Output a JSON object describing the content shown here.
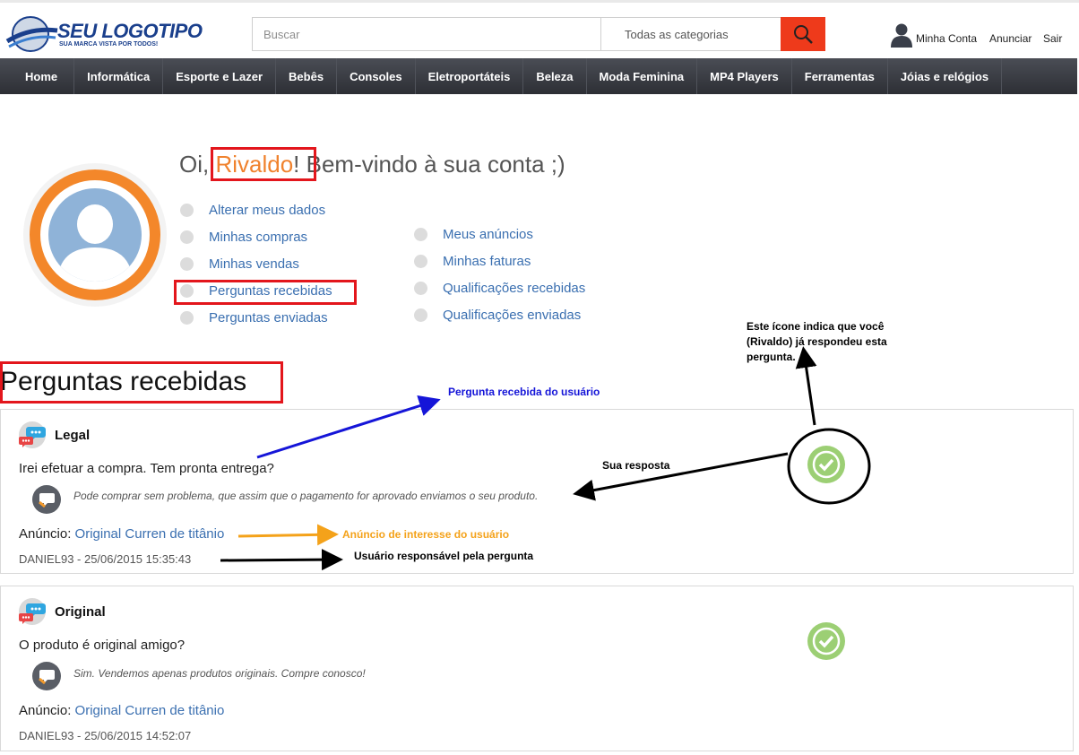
{
  "header": {
    "logo_text": "SEU LOGOTIPO",
    "logo_tagline": "SUA MARCA VISTA POR TODOS!",
    "search_placeholder": "Buscar",
    "category_select": "Todas as categorias",
    "links": {
      "account": "Minha Conta",
      "advertise": "Anunciar",
      "logout": "Sair"
    }
  },
  "nav": [
    "Home",
    "Informática",
    "Esporte e Lazer",
    "Bebês",
    "Consoles",
    "Eletroportáteis",
    "Beleza",
    "Moda Feminina",
    "MP4 Players",
    "Ferramentas",
    "Jóias e relógios"
  ],
  "account": {
    "greeting_prefix": "Oi, ",
    "user_name": "Rivaldo",
    "greeting_suffix": "! Bem-vindo à sua conta ;)",
    "menu_left": [
      "Alterar meus dados",
      "Minhas compras",
      "Minhas vendas",
      "Perguntas recebidas",
      "Perguntas enviadas"
    ],
    "menu_right": [
      "Meus anúncios",
      "Minhas faturas",
      "Qualificações recebidas",
      "Qualificações enviadas"
    ]
  },
  "section_title": "Perguntas recebidas",
  "questions": [
    {
      "title": "Legal",
      "question": "Irei efetuar a compra. Tem pronta entrega?",
      "answer": "Pode comprar sem problema, que assim que o pagamento for aprovado enviamos o seu produto.",
      "ad_label": "Anúncio: ",
      "ad_link": "Original Curren de titânio",
      "meta": "DANIEL93 - 25/06/2015 15:35:43"
    },
    {
      "title": "Original",
      "question": "O produto é original amigo?",
      "answer": "Sim. Vendemos apenas produtos originais. Compre conosco!",
      "ad_label": "Anúncio: ",
      "ad_link": "Original Curren de titânio",
      "meta": "DANIEL93 - 25/06/2015 14:52:07"
    }
  ],
  "annotations": {
    "answered_icon": "Este ícone indica que você (Rivaldo) já respondeu esta pergunta.",
    "question_received": "Pergunta recebida do usuário",
    "your_answer": "Sua resposta",
    "ad_interest": "Anúncio de interesse do usuário",
    "user_responsible": "Usuário responsável pela pergunta"
  },
  "colors": {
    "accent_orange": "#f0822d",
    "link_blue": "#3a6fb0",
    "search_red": "#ee3a1b",
    "check_green": "#9ccf74",
    "annot_blue": "#1515d8",
    "annot_orange": "#f4a21a"
  },
  "icons": [
    "search-icon",
    "user-icon",
    "chat-bubbles-icon",
    "answer-bubble-icon",
    "check-icon"
  ]
}
